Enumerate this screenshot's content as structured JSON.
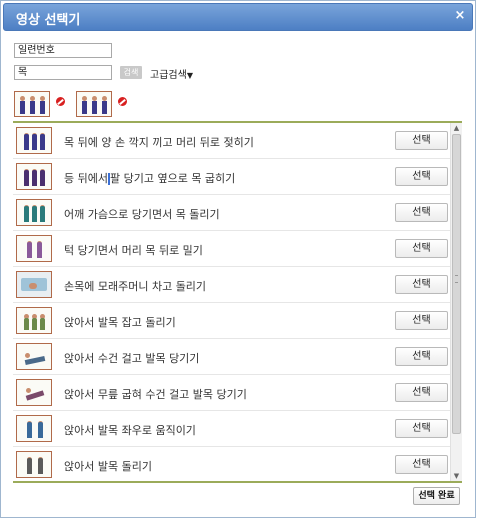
{
  "dialog": {
    "title": "영상 선택기",
    "close_symbol": "×"
  },
  "search": {
    "serial_value": "일련번호",
    "keyword_value": "목",
    "search_label": "검색",
    "advanced_label": "고급검색",
    "advanced_arrow": "▼"
  },
  "list": {
    "select_label": "선택",
    "items": [
      {
        "label": "목 뒤에 양 손 깍지 끼고 머리 뒤로 젖히기"
      },
      {
        "label_before": "등 뒤에서",
        "label_after": "팔 당기고 옆으로 목 굽히기"
      },
      {
        "label": "어깨 가슴으로 당기면서 목 돌리기"
      },
      {
        "label": "턱 당기면서 머리 목 뒤로 밀기"
      },
      {
        "label": "손목에 모래주머니 차고 돌리기"
      },
      {
        "label": "앉아서 발목 잡고 돌리기"
      },
      {
        "label": "앉아서 수건 걸고 발목 당기기"
      },
      {
        "label": "앉아서 무릎 굽혀 수건 걸고 발목 당기기"
      },
      {
        "label": "앉아서 발목 좌우로 움직이기"
      },
      {
        "label": "앉아서 발목 돌리기"
      }
    ]
  },
  "footer": {
    "done_label": "선택 완료"
  },
  "icons": {
    "remove": "no-entry-icon",
    "close": "close-icon"
  },
  "colors": {
    "titlebar": "#5a8bcd",
    "divider": "#9bab5a",
    "thumb_border": "#b06a4a",
    "remove_icon": "#d82020"
  }
}
